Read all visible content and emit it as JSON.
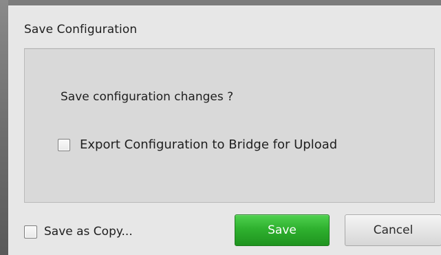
{
  "dialog": {
    "title": "Save Configuration",
    "question": "Save configuration changes ?",
    "export_option": {
      "label": "Export Configuration to Bridge for Upload",
      "checked": false
    },
    "save_as_copy": {
      "label": "Save as Copy...",
      "checked": false
    },
    "buttons": {
      "save_label": "Save",
      "cancel_label": "Cancel"
    },
    "colors": {
      "save_button": "#2fb12f",
      "panel": "#d9d9d9",
      "dialog": "#e7e7e7"
    }
  }
}
